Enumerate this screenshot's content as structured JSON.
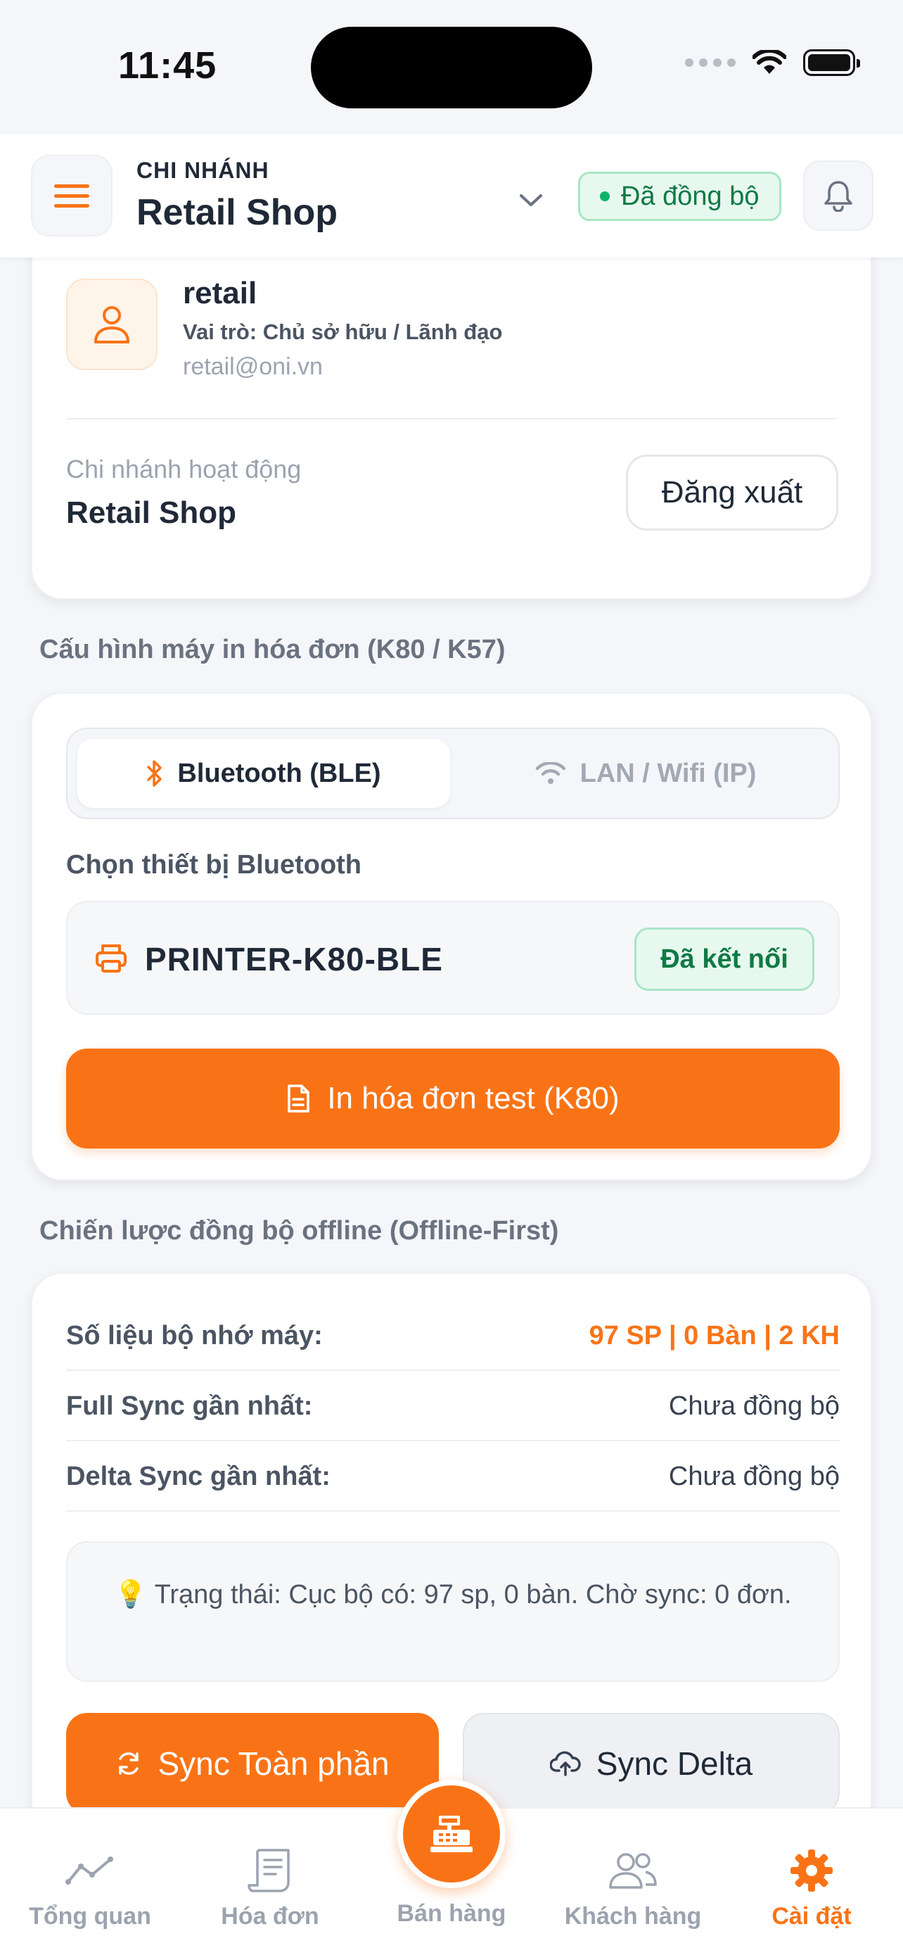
{
  "status_bar": {
    "time": "11:45"
  },
  "header": {
    "branch_caption": "CHI NHÁNH",
    "branch_name": "Retail Shop",
    "sync_status": "Đã đồng bộ"
  },
  "account": {
    "username": "retail",
    "role": "Vai trò: Chủ sở hữu / Lãnh đạo",
    "email": "retail@oni.vn",
    "active_branch_label": "Chi nhánh hoạt động",
    "active_branch_value": "Retail Shop",
    "logout_label": "Đăng xuất"
  },
  "printer": {
    "section_title": "Cấu hình máy in hóa đơn (K80 / K57)",
    "tabs": [
      {
        "label": "Bluetooth (BLE)",
        "active": true
      },
      {
        "label": "LAN / Wifi (IP)",
        "active": false
      }
    ],
    "device_label": "Chọn thiết bị Bluetooth",
    "device_name": "PRINTER-K80-BLE",
    "device_status": "Đã kết nối",
    "test_print_label": "In hóa đơn test (K80)"
  },
  "sync": {
    "section_title": "Chiến lược đồng bộ offline (Offline-First)",
    "rows": [
      {
        "key": "Số liệu bộ nhớ máy:",
        "value": "97 SP | 0 Bàn | 2 KH"
      },
      {
        "key": "Full Sync gần nhất:",
        "value": "Chưa đồng bộ"
      },
      {
        "key": "Delta Sync gần nhất:",
        "value": "Chưa đồng bộ"
      }
    ],
    "status_text": "Trạng thái: Cục bộ có: 97 sp, 0 bàn. Chờ sync: 0 đơn.",
    "full_sync_label": "Sync Toàn phần",
    "delta_sync_label": "Sync Delta"
  },
  "nav": {
    "items": [
      {
        "label": "Tổng quan",
        "icon": "chart-line-icon",
        "active": false
      },
      {
        "label": "Hóa đơn",
        "icon": "receipt-icon",
        "active": false
      },
      {
        "label": "Bán hàng",
        "icon": "cash-register-icon",
        "active": false
      },
      {
        "label": "Khách hàng",
        "icon": "users-icon",
        "active": false
      },
      {
        "label": "Cài đặt",
        "icon": "gear-icon",
        "active": true
      }
    ]
  },
  "colors": {
    "accent": "#f97316",
    "success_bg": "#e7f8ef",
    "success_text": "#0f7a45",
    "background": "#f4f6f9"
  }
}
